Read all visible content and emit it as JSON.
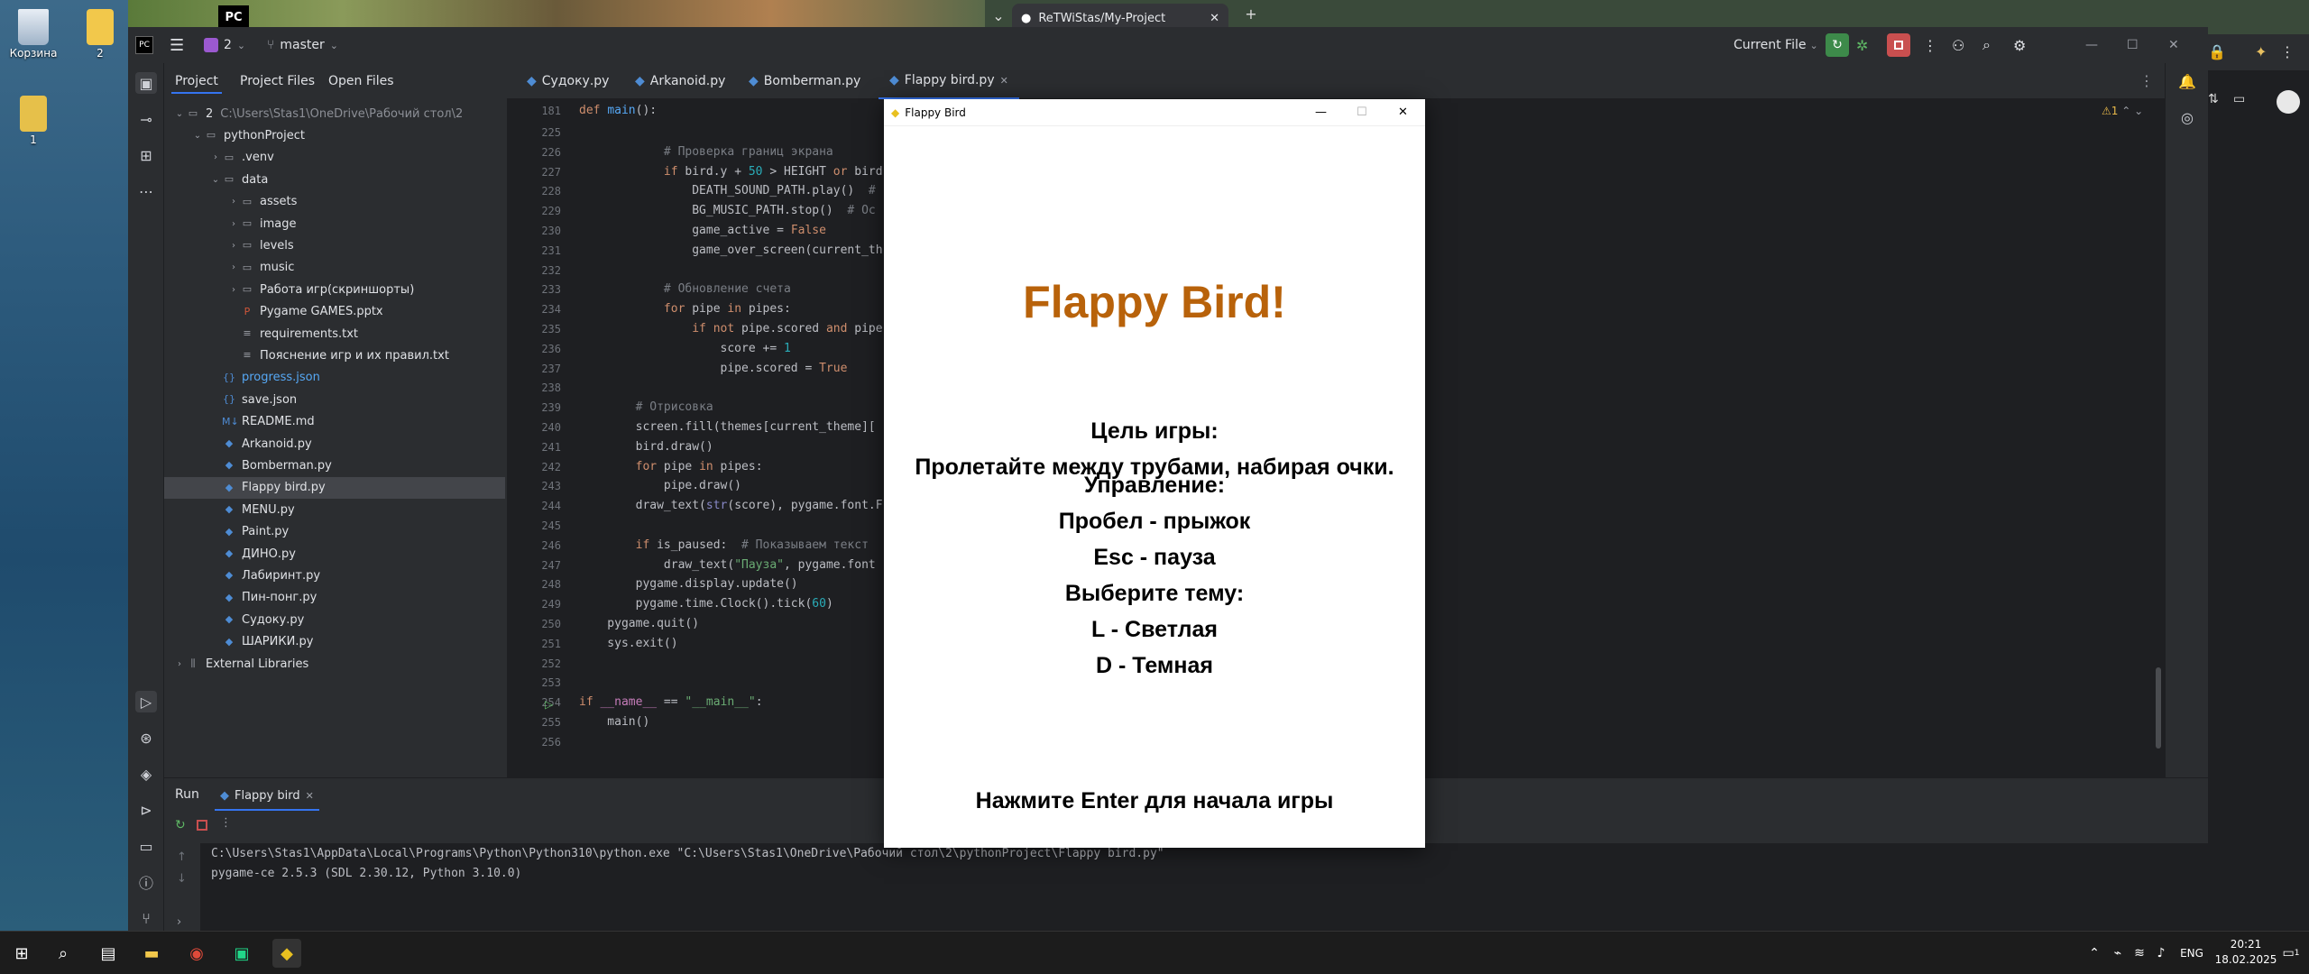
{
  "desktop": {
    "icons": [
      {
        "label": "Корзина"
      },
      {
        "label": "2"
      },
      {
        "label": "1"
      }
    ]
  },
  "browser": {
    "tab_title": "ReTWiStas/My-Project",
    "new_tab": "+",
    "controls": [
      "—",
      "☐",
      "✕"
    ]
  },
  "ide": {
    "project_badge": "2",
    "branch": "master",
    "run_config": "Current File",
    "window_controls": [
      "—",
      "☐",
      "✕"
    ]
  },
  "project_panel": {
    "tabs": [
      "Project",
      "Project Files",
      "Open Files"
    ],
    "tree": [
      {
        "depth": 0,
        "chev": "⌄",
        "icon": "folder",
        "label": "2",
        "suffix": "C:\\Users\\Stas1\\OneDrive\\Рабочий стол\\2"
      },
      {
        "depth": 1,
        "chev": "⌄",
        "icon": "folder",
        "label": "pythonProject"
      },
      {
        "depth": 2,
        "chev": "›",
        "icon": "folder",
        "label": ".venv"
      },
      {
        "depth": 2,
        "chev": "⌄",
        "icon": "folder",
        "label": "data"
      },
      {
        "depth": 3,
        "chev": "›",
        "icon": "folder",
        "label": "assets"
      },
      {
        "depth": 3,
        "chev": "›",
        "icon": "folder",
        "label": "image"
      },
      {
        "depth": 3,
        "chev": "›",
        "icon": "folder",
        "label": "levels"
      },
      {
        "depth": 3,
        "chev": "›",
        "icon": "folder",
        "label": "music"
      },
      {
        "depth": 3,
        "chev": "›",
        "icon": "folder",
        "label": "Работа игр(скриншорты)"
      },
      {
        "depth": 3,
        "chev": "",
        "icon": "ppt",
        "label": "Pygame GAMES.pptx"
      },
      {
        "depth": 3,
        "chev": "",
        "icon": "txt",
        "label": "requirements.txt"
      },
      {
        "depth": 3,
        "chev": "",
        "icon": "txt",
        "label": "Пояснение игр и их правил.txt"
      },
      {
        "depth": 2,
        "chev": "",
        "icon": "json",
        "label": "progress.json",
        "blue": true
      },
      {
        "depth": 2,
        "chev": "",
        "icon": "json",
        "label": "save.json"
      },
      {
        "depth": 2,
        "chev": "",
        "icon": "md",
        "label": "README.md"
      },
      {
        "depth": 2,
        "chev": "",
        "icon": "py",
        "label": "Arkanoid.py"
      },
      {
        "depth": 2,
        "chev": "",
        "icon": "py",
        "label": "Bomberman.py"
      },
      {
        "depth": 2,
        "chev": "",
        "icon": "py",
        "label": "Flappy bird.py",
        "selected": true
      },
      {
        "depth": 2,
        "chev": "",
        "icon": "py",
        "label": "MENU.py"
      },
      {
        "depth": 2,
        "chev": "",
        "icon": "py",
        "label": "Paint.py"
      },
      {
        "depth": 2,
        "chev": "",
        "icon": "py",
        "label": "ДИНО.py"
      },
      {
        "depth": 2,
        "chev": "",
        "icon": "py",
        "label": "Лабиринт.py"
      },
      {
        "depth": 2,
        "chev": "",
        "icon": "py",
        "label": "Пин-понг.py"
      },
      {
        "depth": 2,
        "chev": "",
        "icon": "py",
        "label": "Судоку.py"
      },
      {
        "depth": 2,
        "chev": "",
        "icon": "py",
        "label": "ШАРИКИ.py"
      },
      {
        "depth": 0,
        "chev": "›",
        "icon": "lib",
        "label": "External Libraries"
      }
    ]
  },
  "editor": {
    "tabs": [
      {
        "label": "Судоку.py"
      },
      {
        "label": "Arkanoid.py"
      },
      {
        "label": "Bomberman.py"
      },
      {
        "label": "Flappy bird.py",
        "active": true
      }
    ],
    "sticky_line": {
      "num": "181",
      "html": "<span class='kw'>def</span> <span class='fn'>main</span>():"
    },
    "warning_count": "1",
    "lines": [
      {
        "num": "225",
        "html": ""
      },
      {
        "num": "226",
        "html": "            <span class='cm'># Проверка границ экрана</span>"
      },
      {
        "num": "227",
        "html": "            <span class='kw'>if</span> bird.y + <span class='num'>50</span> &gt; HEIGHT <span class='kw'>or</span> bird"
      },
      {
        "num": "228",
        "html": "                DEATH_SOUND_PATH.play()  <span class='cm'>#</span>"
      },
      {
        "num": "229",
        "html": "                BG_MUSIC_PATH.stop()  <span class='cm'># Ос</span>"
      },
      {
        "num": "230",
        "html": "                game_active = <span class='kw'>False</span>"
      },
      {
        "num": "231",
        "html": "                game_over_screen(current_th"
      },
      {
        "num": "232",
        "html": ""
      },
      {
        "num": "233",
        "html": "            <span class='cm'># Обновление счета</span>"
      },
      {
        "num": "234",
        "html": "            <span class='kw'>for</span> pipe <span class='kw'>in</span> pipes:"
      },
      {
        "num": "235",
        "html": "                <span class='kw'>if not</span> pipe.scored <span class='kw'>and</span> pipe"
      },
      {
        "num": "236",
        "html": "                    score += <span class='num'>1</span>"
      },
      {
        "num": "237",
        "html": "                    pipe.scored = <span class='kw'>True</span>"
      },
      {
        "num": "238",
        "html": ""
      },
      {
        "num": "239",
        "html": "        <span class='cm'># Отрисовка</span>"
      },
      {
        "num": "240",
        "html": "        screen.fill(themes[current_theme]["
      },
      {
        "num": "241",
        "html": "        bird.draw()"
      },
      {
        "num": "242",
        "html": "        <span class='kw'>for</span> pipe <span class='kw'>in</span> pipes:"
      },
      {
        "num": "243",
        "html": "            pipe.draw()"
      },
      {
        "num": "244",
        "html": "        draw_text(<span class='bi'>str</span>(score), pygame.font.F"
      },
      {
        "num": "245",
        "html": ""
      },
      {
        "num": "246",
        "html": "        <span class='kw'>if</span> is_paused:  <span class='cm'># Показываем текст</span>"
      },
      {
        "num": "247",
        "html": "            draw_text(<span class='str'>\"Пауза\"</span>, pygame.font"
      },
      {
        "num": "248",
        "html": "        pygame.display.update()"
      },
      {
        "num": "249",
        "html": "        pygame.time.Clock().tick(<span class='num'>60</span>)"
      },
      {
        "num": "250",
        "html": "    pygame.quit()"
      },
      {
        "num": "251",
        "html": "    sys.exit()"
      },
      {
        "num": "252",
        "html": ""
      },
      {
        "num": "253",
        "html": ""
      },
      {
        "num": "254",
        "html": "<span class='kw'>if</span> <span class='cst'>__name__</span> == <span class='str'>\"__main__\"</span>:"
      },
      {
        "num": "255",
        "html": "    main()"
      },
      {
        "num": "256",
        "html": ""
      }
    ]
  },
  "run_panel": {
    "title": "Run",
    "tab": "Flappy bird",
    "output": [
      "C:\\Users\\Stas1\\AppData\\Local\\Programs\\Python\\Python310\\python.exe \"C:\\Users\\Stas1\\OneDrive\\Рабочий стол\\2\\pythonProject\\Flappy bird.py\"",
      "pygame-ce 2.5.3 (SDL 2.30.12, Python 3.10.0)"
    ]
  },
  "game_window": {
    "title": "Flappy Bird",
    "controls": [
      "—",
      "☐",
      "✕"
    ],
    "heading": "Flappy Bird!",
    "heading_color": "#b8620a",
    "goal_title": "Цель игры:",
    "goal_text": "Пролетайте между трубами, набирая очки.",
    "controls_title": "Управление:",
    "control_jump": "Пробел - прыжок",
    "control_pause": "Esc - пауза",
    "theme_title": "Выберите тему:",
    "theme_light": "L - Светлая",
    "theme_dark": "D - Темная",
    "start_hint": "Нажмите Enter для начала игры"
  },
  "taskbar": {
    "lang": "ENG",
    "time": "20:21",
    "date": "18.02.2025",
    "notifications": "1"
  }
}
